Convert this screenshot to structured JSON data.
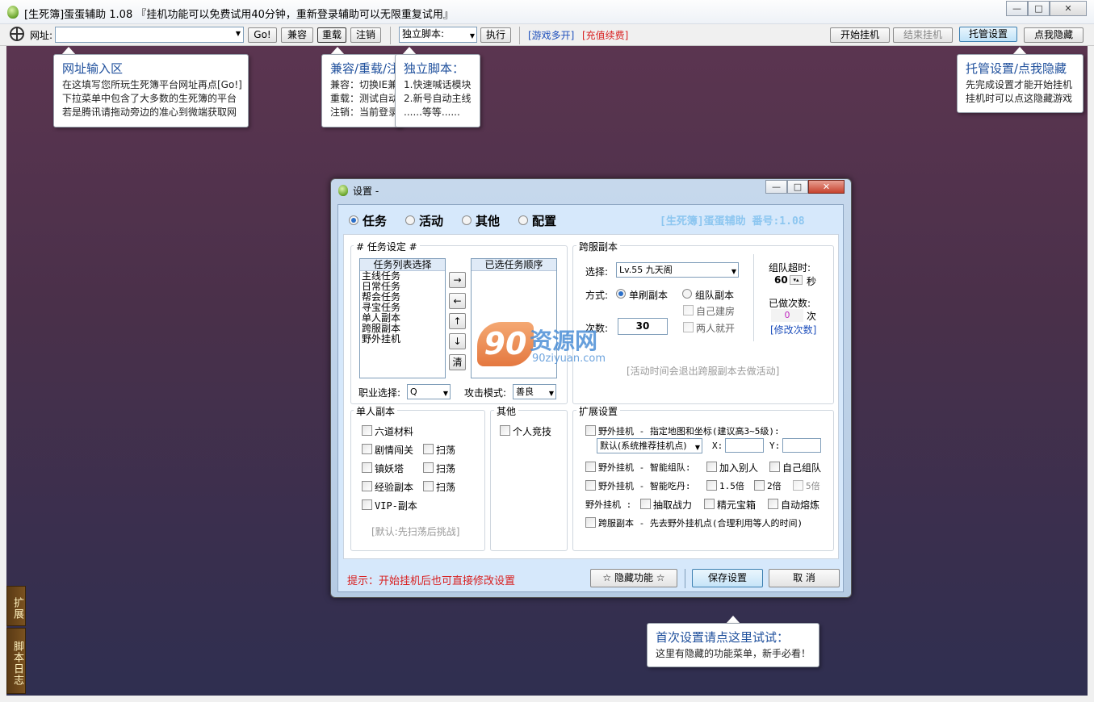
{
  "window": {
    "title": "[生死簿]蛋蛋辅助 1.08 『挂机功能可以免费试用40分钟，重新登录辅助可以无限重复试用』",
    "minimize": "—",
    "maximize": "□",
    "close": "✕"
  },
  "toolbar": {
    "url_label": "网址:",
    "go": "Go!",
    "compat": "兼容",
    "reload": "重载",
    "logout": "注销",
    "script_select": "独立脚本:",
    "execute": "执行",
    "multi_open": "[游戏多开]",
    "recharge": "[充值续费]",
    "start": "开始挂机",
    "stop": "结束挂机",
    "hosting": "托管设置",
    "hide": "点我隐藏"
  },
  "tips": {
    "url": {
      "title": "网址输入区",
      "lines": [
        "在这填写您所玩生死簿平台网址再点[Go!]",
        "下拉菜单中包含了大多数的生死簿的平台",
        "若是腾讯请拖动旁边的准心到微端获取网"
      ]
    },
    "compat": {
      "title": "兼容/重载/注",
      "lines": [
        "兼容：切换IE兼",
        "重载：测试自动",
        "注销：当前登录"
      ]
    },
    "script": {
      "title": "独立脚本：",
      "lines": [
        "1.快速喊话模块",
        "2.新号自动主线",
        "......等等......"
      ]
    },
    "hosting": {
      "title": "托管设置/点我隐藏",
      "lines": [
        "先完成设置才能开始挂机",
        "挂机时可以点这隐藏游戏"
      ]
    },
    "first": {
      "title": "首次设置请点这里试试：",
      "lines": [
        "这里有隐藏的功能菜单，新手必看！"
      ]
    }
  },
  "side": {
    "expand": "扩展",
    "log": "脚本日志"
  },
  "dialog": {
    "title": "设置 -",
    "tabs": [
      "任务",
      "活动",
      "其他",
      "配置"
    ],
    "brand": "[生死簿]蛋蛋辅助 番号:1.08",
    "task": {
      "legend": "# 任务设定 #",
      "list_header": "任务列表选择",
      "items": [
        "主线任务",
        "日常任务",
        "帮会任务",
        "寻宝任务",
        "单人副本",
        "跨服副本",
        "野外挂机"
      ],
      "selected_header": "已选任务顺序",
      "btn_right": "→",
      "btn_left": "←",
      "btn_up": "↑",
      "btn_down": "↓",
      "btn_clear": "清",
      "job_label": "职业选择:",
      "job_value": "Q",
      "attack_label": "攻击模式:",
      "attack_value": "善良"
    },
    "cross": {
      "legend": "跨服副本",
      "select_label": "选择:",
      "select_value": "Lv.55  九天阁",
      "mode_label": "方式:",
      "single": "单刷副本",
      "team": "组队副本",
      "self_room": "自己建房",
      "two_open": "两人就开",
      "count_label": "次数:",
      "count_value": "30",
      "timeout_label": "组队超时:",
      "timeout_value": "60",
      "timeout_unit": "秒",
      "done_label": "已做次数:",
      "done_value": "0",
      "done_unit": "次",
      "modify": "[修改次数]",
      "note": "[活动时间会退出跨服副本去做活动]"
    },
    "solo": {
      "legend": "单人副本",
      "items": [
        "六道材料",
        "剧情闯关",
        "镇妖塔",
        "经验副本",
        "VIP-副本"
      ],
      "sweep": "扫荡",
      "note": "[默认:先扫荡后挑战]"
    },
    "other": {
      "legend": "其他",
      "item": "个人竞技"
    },
    "ext": {
      "legend": "扩展设置",
      "line1": "野外挂机 - 指定地图和坐标(建议高3~5级):",
      "map_select": "默认(系统推荐挂机点)",
      "x_label": "X:",
      "y_label": "Y:",
      "line2": "野外挂机 - 智能组队:",
      "join": "加入别人",
      "own": "自己组队",
      "line3": "野外挂机 - 智能吃丹:",
      "x15": "1.5倍",
      "x2": "2倍",
      "x5": "5倍",
      "line4": "野外挂机 :",
      "draw": "抽取战力",
      "box": "精元宝箱",
      "melt": "自动熔炼",
      "line5": "跨服副本 - 先去野外挂机点(合理利用等人的时间)"
    },
    "hint": "提示：开始挂机后也可直接修改设置",
    "hidden_btn": "☆ 隐藏功能 ☆",
    "save": "保存设置",
    "cancel": "取 消"
  },
  "watermark": {
    "logo": "90",
    "text": "资源网",
    "url": "90ziyuan.com"
  },
  "colors": {
    "accent_blue": "#1e4f9c",
    "red": "#d81e1e",
    "brand": "#8cc6f0"
  }
}
